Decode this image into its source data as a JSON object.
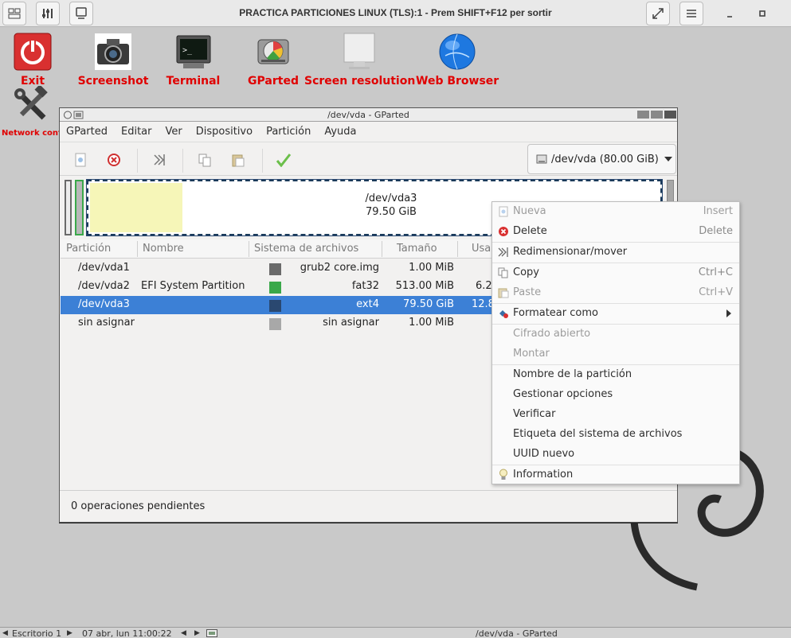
{
  "topbar": {
    "title": "PRACTICA PARTICIONES LINUX (TLS):1 - Prem SHIFT+F12 per sortir",
    "icons": [
      "remote-desktop-icon",
      "settings-sliders-icon",
      "monitor-icon",
      "fullscreen-icon",
      "hamburger-menu-icon",
      "minimize-icon",
      "maximize-icon"
    ]
  },
  "desktop": {
    "icons": [
      {
        "label": "Exit",
        "icon": "power-icon"
      },
      {
        "label": "Screenshot",
        "icon": "camera-icon"
      },
      {
        "label": "Terminal",
        "icon": "terminal-icon"
      },
      {
        "label": "GParted",
        "icon": "disk-icon"
      },
      {
        "label": "Screen resolution",
        "icon": "screen-icon"
      },
      {
        "label": "Web Browser",
        "icon": "globe-icon"
      },
      {
        "label": "Network conf",
        "icon": "tools-icon"
      }
    ]
  },
  "window": {
    "title": "/dev/vda - GParted",
    "menu": [
      "GParted",
      "Editar",
      "Ver",
      "Dispositivo",
      "Partición",
      "Ayuda"
    ],
    "device_selector": "/dev/vda (80.00 GiB)",
    "diskmap": {
      "name": "/dev/vda3",
      "size": "79.50 GiB"
    },
    "columns": [
      "Partición",
      "Nombre",
      "Sistema de archivos",
      "Tamaño",
      "Usa"
    ],
    "rows": [
      {
        "partition": "/dev/vda1",
        "name": "",
        "color": "#6a6a6a",
        "fs": "grub2 core.img",
        "size": "1.00 MiB",
        "used": "",
        "selected": false
      },
      {
        "partition": "/dev/vda2",
        "name": "EFI System Partition",
        "color": "#3aa84a",
        "fs": "fat32",
        "size": "513.00 MiB",
        "used": "6.2",
        "selected": false
      },
      {
        "partition": "/dev/vda3",
        "name": "",
        "color": "#2a4870",
        "fs": "ext4",
        "size": "79.50 GiB",
        "used": "12.8",
        "selected": true
      },
      {
        "partition": "sin asignar",
        "name": "",
        "color": "#a8a8a8",
        "fs": "sin asignar",
        "size": "1.00 MiB",
        "used": "",
        "selected": false
      }
    ],
    "status": "0 operaciones pendientes"
  },
  "context_menu": {
    "items": [
      {
        "label": "Nueva",
        "shortcut": "Insert",
        "disabled": true
      },
      {
        "label": "Delete",
        "shortcut": "Delete",
        "disabled": false
      },
      {
        "label": "Redimensionar/mover",
        "shortcut": "",
        "disabled": false
      },
      {
        "label": "Copy",
        "shortcut": "Ctrl+C",
        "disabled": false
      },
      {
        "label": "Paste",
        "shortcut": "Ctrl+V",
        "disabled": true
      },
      {
        "label": "Formatear como",
        "shortcut": "",
        "disabled": false
      },
      {
        "label": "Cifrado abierto",
        "shortcut": "",
        "disabled": true
      },
      {
        "label": "Montar",
        "shortcut": "",
        "disabled": true
      },
      {
        "label": "Nombre de la partición",
        "shortcut": "",
        "disabled": false
      },
      {
        "label": "Gestionar opciones",
        "shortcut": "",
        "disabled": false
      },
      {
        "label": "Verificar",
        "shortcut": "",
        "disabled": false
      },
      {
        "label": "Etiqueta del sistema de archivos",
        "shortcut": "",
        "disabled": false
      },
      {
        "label": "UUID nuevo",
        "shortcut": "",
        "disabled": false
      },
      {
        "label": "Information",
        "shortcut": "",
        "disabled": false
      }
    ]
  },
  "taskbar": {
    "workspace": "Escritorio 1",
    "datetime": "07 abr, lun 11:00:22",
    "task": "/dev/vda - GParted"
  },
  "colors": {
    "selection": "#3c80d6",
    "desktop_label": "#e00000",
    "vda3_fill": "#f6f6b8"
  }
}
